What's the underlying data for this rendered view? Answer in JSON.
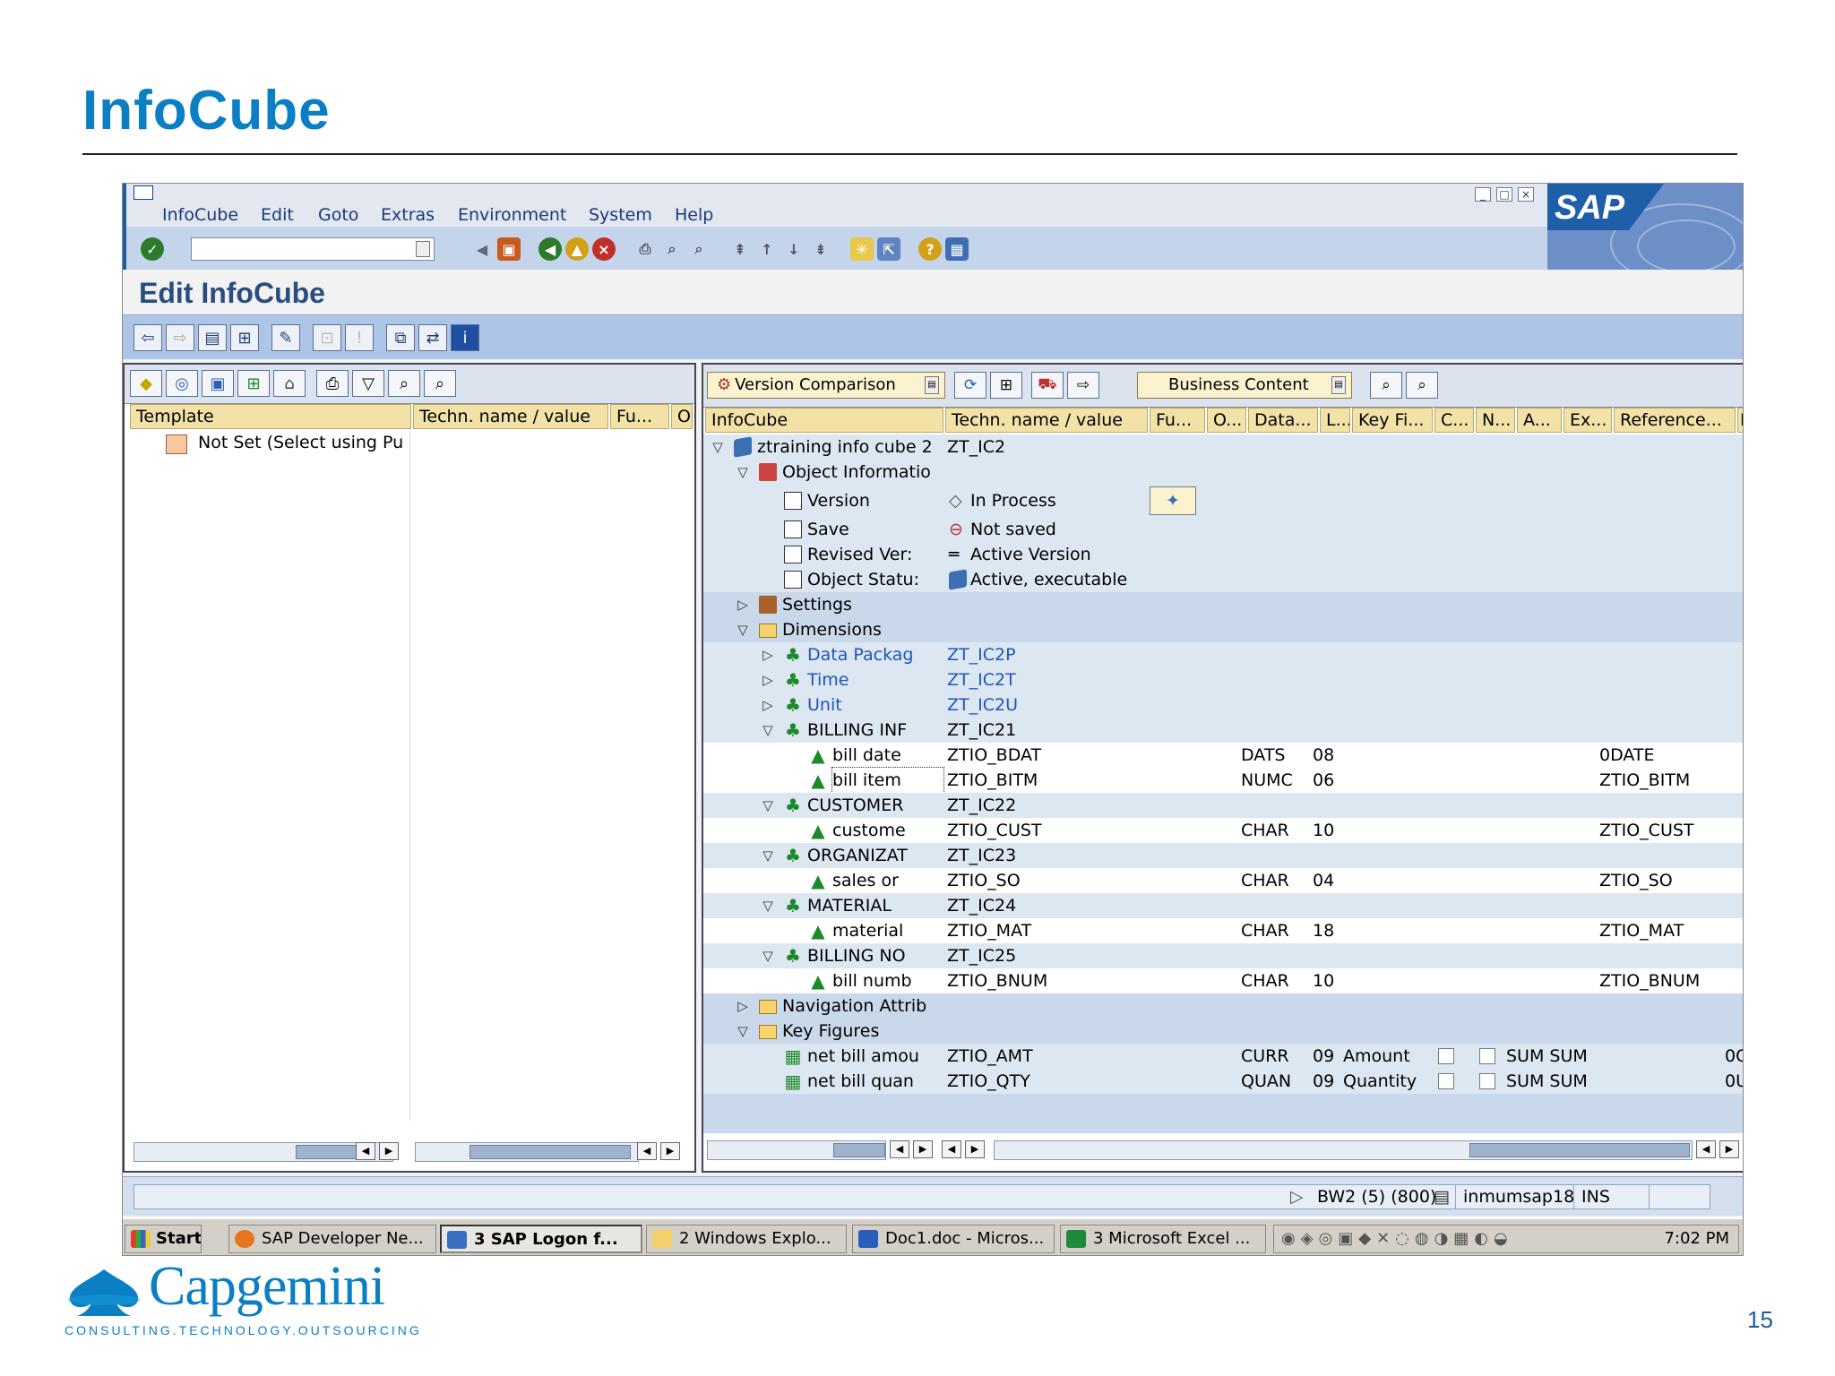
{
  "slide": {
    "title": "InfoCube",
    "page_number": "15"
  },
  "logo": {
    "wordmark": "Capgemini",
    "tagline": "CONSULTING.TECHNOLOGY.OUTSOURCING"
  },
  "sap": {
    "menu": [
      "InfoCube",
      "Edit",
      "Goto",
      "Extras",
      "Environment",
      "System",
      "Help"
    ],
    "logo_text": "SAP",
    "screen_title": "Edit InfoCube",
    "left_pane": {
      "headers": [
        "Template",
        "Techn. name / value",
        "Fu...",
        "O"
      ],
      "row": "Not Set (Select using Pu"
    },
    "right_pane": {
      "version_dropdown": "Version Comparison",
      "content_dropdown": "Business Content",
      "headers": [
        "InfoCube",
        "Techn. name / value",
        "Fu...",
        "O...",
        "Data...",
        "L...",
        "Key Fi...",
        "C...",
        "N...",
        "A...",
        "Ex...",
        "Reference...",
        "L"
      ],
      "rows": [
        {
          "name": "ztraining info cube 2",
          "tech": "ZT_IC2"
        },
        {
          "name": "Object Informatio",
          "tech": ""
        },
        {
          "name": "Version",
          "tech": "In Process"
        },
        {
          "name": "Save",
          "tech": "Not saved"
        },
        {
          "name": "Revised Ver:",
          "tech": "Active Version"
        },
        {
          "name": "Object Statu:",
          "tech": "Active, executable"
        },
        {
          "name": "Settings",
          "tech": ""
        },
        {
          "name": "Dimensions",
          "tech": ""
        },
        {
          "name": "Data Packag",
          "tech": "ZT_IC2P"
        },
        {
          "name": "Time",
          "tech": "ZT_IC2T"
        },
        {
          "name": "Unit",
          "tech": "ZT_IC2U"
        },
        {
          "name": "BILLING INF",
          "tech": "ZT_IC21"
        },
        {
          "name": "bill date",
          "tech": "ZTIO_BDAT",
          "type": "DATS",
          "len": "08",
          "ref": "0DATE"
        },
        {
          "name": "bill item",
          "tech": "ZTIO_BITM",
          "type": "NUMC",
          "len": "06",
          "ref": "ZTIO_BITM"
        },
        {
          "name": "CUSTOMER",
          "tech": "ZT_IC22"
        },
        {
          "name": "custome",
          "tech": "ZTIO_CUST",
          "type": "CHAR",
          "len": "10",
          "ref": "ZTIO_CUST"
        },
        {
          "name": "ORGANIZAT",
          "tech": "ZT_IC23"
        },
        {
          "name": "sales or",
          "tech": "ZTIO_SO",
          "type": "CHAR",
          "len": "04",
          "ref": "ZTIO_SO"
        },
        {
          "name": "MATERIAL",
          "tech": "ZT_IC24"
        },
        {
          "name": "material",
          "tech": "ZTIO_MAT",
          "type": "CHAR",
          "len": "18",
          "ref": "ZTIO_MAT"
        },
        {
          "name": "BILLING NO",
          "tech": "ZT_IC25"
        },
        {
          "name": "bill numb",
          "tech": "ZTIO_BNUM",
          "type": "CHAR",
          "len": "10",
          "ref": "ZTIO_BNUM"
        },
        {
          "name": "Navigation Attrib",
          "tech": ""
        },
        {
          "name": "Key Figures",
          "tech": ""
        },
        {
          "name": "net bill amou",
          "tech": "ZTIO_AMT",
          "type": "CURR",
          "len": "09",
          "kf": "Amount",
          "agg": "SUM SUM",
          "end": "0C"
        },
        {
          "name": "net bill quan",
          "tech": "ZTIO_QTY",
          "type": "QUAN",
          "len": "09",
          "kf": "Quantity",
          "agg": "SUM SUM",
          "end": "0U"
        }
      ]
    },
    "status": {
      "system": "BW2 (5) (800)",
      "server": "inmumsap18",
      "mode": "INS"
    },
    "taskbar": {
      "start": "Start",
      "tasks": [
        "SAP Developer Ne...",
        "3 SAP Logon f...",
        "2 Windows Explo...",
        "Doc1.doc - Micros...",
        "3 Microsoft Excel ..."
      ],
      "clock": "7:02 PM"
    }
  }
}
